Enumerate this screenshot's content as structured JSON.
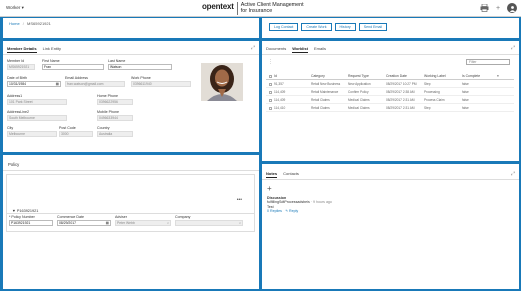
{
  "header": {
    "worker_label": "Worker ▾",
    "brand": "opentext",
    "product_line1": "Active Client Management",
    "product_line2": "for Insurance"
  },
  "breadcrumb": {
    "home": "Home",
    "separator": "/",
    "current": "MS65921921"
  },
  "actions": [
    "Log Contact",
    "Create Work",
    "History",
    "Send Email"
  ],
  "member_panel": {
    "tabs": [
      "Member Details",
      "Link Entity"
    ],
    "fields": {
      "member_id": {
        "label": "Member Id",
        "value": "MS65921921"
      },
      "first_name": {
        "label": "First Name",
        "value": "Fran"
      },
      "last_name": {
        "label": "Last Name",
        "value": "Watson"
      },
      "dob": {
        "label": "Date of Birth",
        "value": "10/31/1984"
      },
      "email": {
        "label": "Email Address",
        "value": "fran.watson@gmail.com"
      },
      "work_phone": {
        "label": "Work Phone",
        "value": "0396611940"
      },
      "address1": {
        "label": "Address1",
        "value": "101 Park Street"
      },
      "home_phone": {
        "label": "Home Phone",
        "value": "0396622956"
      },
      "address2": {
        "label": "AddressLine2",
        "value": "South Melbourne"
      },
      "mobile_phone": {
        "label": "Mobile Phone",
        "value": "0496633944"
      },
      "city": {
        "label": "City",
        "value": "Melbourne"
      },
      "post_code": {
        "label": "Post Code",
        "value": "3000"
      },
      "country": {
        "label": "Country",
        "value": "Australia"
      }
    }
  },
  "work_panel": {
    "tabs": [
      "Documents",
      "Worklist",
      "Emails"
    ],
    "filter_placeholder": "Filter",
    "columns": [
      "Id",
      "Category",
      "Request Type",
      "Creation Date",
      "Working Label",
      "Is Complete"
    ],
    "rows": [
      [
        "91,357",
        "Retail New Business",
        "New Application",
        "08/29/2017 10:27 PM",
        "Step",
        "false"
      ],
      [
        "114,409",
        "Retail Maintenance",
        "Confirm Policy",
        "08/29/2017 2:38 AM",
        "Processing",
        "false"
      ],
      [
        "114,409",
        "Retail Claims",
        "Medical Claims",
        "08/29/2017 2:31 AM",
        "Process Claim",
        "false"
      ],
      [
        "114,410",
        "Retail Claims",
        "Medical Claims",
        "08/29/2017 2:31 AM",
        "Step",
        "false"
      ]
    ]
  },
  "policy_panel": {
    "title": "Policy",
    "policy_name": "P163921921",
    "fields": {
      "policy_number": {
        "label": "* Policy Number",
        "value": "P163921921"
      },
      "commence": {
        "label": "Commence Date",
        "value": "08/29/2017"
      },
      "adviser": {
        "label": "Adviser",
        "value": "Peter Webb"
      },
      "company": {
        "label": "Company",
        "value": ""
      }
    }
  },
  "notes_panel": {
    "tabs": [
      "Notes",
      "Contacts"
    ],
    "discussion_title": "Discussion",
    "discussion_author": "fulfillingSdtProcessadsbeis",
    "discussion_time": "9 hours ago",
    "discussion_text": "Test",
    "replies": "0 Replies",
    "reply_link": "↰ Reply"
  }
}
